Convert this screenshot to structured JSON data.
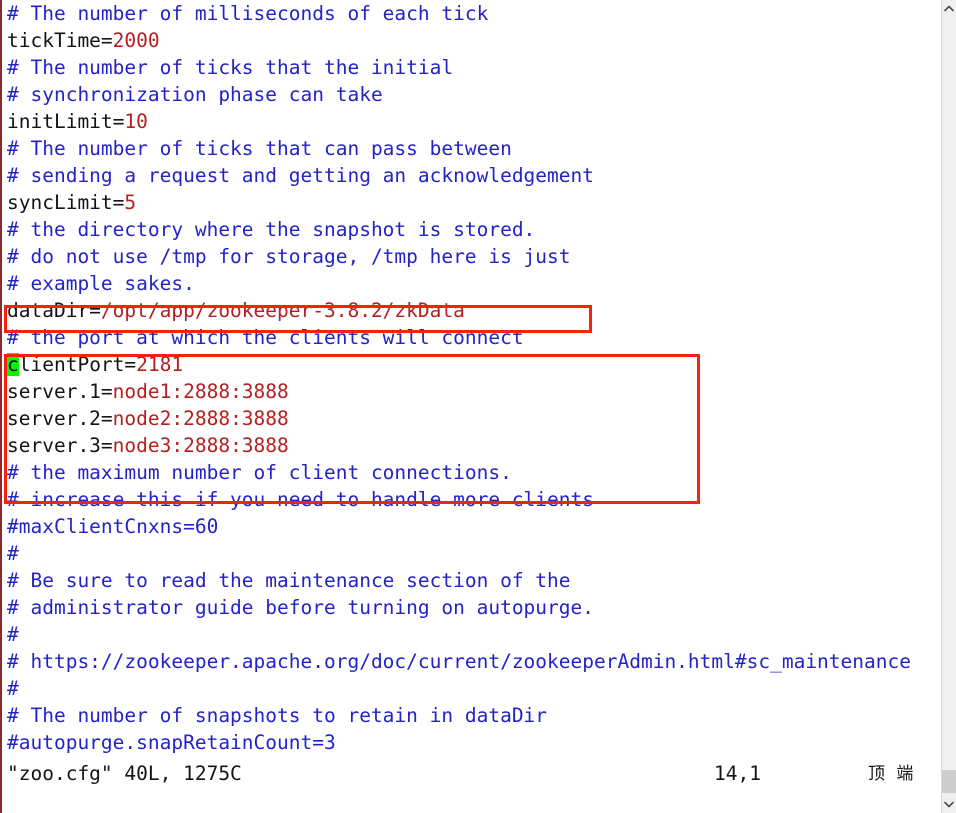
{
  "window": {
    "app": "vim",
    "filename": "zoo.cfg"
  },
  "editor": {
    "lines": [
      {
        "type": "comment",
        "text": "# The number of milliseconds of each tick"
      },
      {
        "type": "setting",
        "key": "tickTime=",
        "value": "2000"
      },
      {
        "type": "comment",
        "text": "# The number of ticks that the initial"
      },
      {
        "type": "comment",
        "text": "# synchronization phase can take"
      },
      {
        "type": "setting",
        "key": "initLimit=",
        "value": "10"
      },
      {
        "type": "comment",
        "text": "# The number of ticks that can pass between"
      },
      {
        "type": "comment",
        "text": "# sending a request and getting an acknowledgement"
      },
      {
        "type": "setting",
        "key": "syncLimit=",
        "value": "5"
      },
      {
        "type": "comment",
        "text": "# the directory where the snapshot is stored."
      },
      {
        "type": "comment",
        "text": "# do not use /tmp for storage, /tmp here is just"
      },
      {
        "type": "comment",
        "text": "# example sakes."
      },
      {
        "type": "setting",
        "key": "dataDir=",
        "value": "/opt/app/zookeeper-3.8.2/zkData"
      },
      {
        "type": "comment",
        "text": "# the port at which the clients will connect"
      },
      {
        "type": "setting-cursor",
        "cursor": "c",
        "key": "lientPort=",
        "value": "2181"
      },
      {
        "type": "setting",
        "key": "server.1=",
        "value": "node1:2888:3888"
      },
      {
        "type": "setting",
        "key": "server.2=",
        "value": "node2:2888:3888"
      },
      {
        "type": "setting",
        "key": "server.3=",
        "value": "node3:2888:3888"
      },
      {
        "type": "comment",
        "text": "# the maximum number of client connections."
      },
      {
        "type": "comment",
        "text": "# increase this if you need to handle more clients"
      },
      {
        "type": "comment",
        "text": "#maxClientCnxns=60"
      },
      {
        "type": "comment",
        "text": "#"
      },
      {
        "type": "comment",
        "text": "# Be sure to read the maintenance section of the"
      },
      {
        "type": "comment",
        "text": "# administrator guide before turning on autopurge."
      },
      {
        "type": "comment",
        "text": "#"
      },
      {
        "type": "comment",
        "text": "# https://zookeeper.apache.org/doc/current/zookeeperAdmin.html#sc_maintenance"
      },
      {
        "type": "comment",
        "text": "#"
      },
      {
        "type": "comment",
        "text": "# The number of snapshots to retain in dataDir"
      },
      {
        "type": "comment",
        "text": "#autopurge.snapRetainCount=3"
      }
    ]
  },
  "statusline": {
    "file_info": "\"zoo.cfg\" 40L, 1275C",
    "cursor_position": "14,1",
    "location": "顶 端"
  },
  "annotations": [
    {
      "name": "datadir-highlight",
      "color": "#f92010"
    },
    {
      "name": "server-config-highlight",
      "color": "#f92010"
    }
  ],
  "scrollbar": {
    "up_arrow": "chevron-up-icon",
    "down_arrow": "chevron-down-icon",
    "thumb": "scrollbar-thumb"
  },
  "colors": {
    "comment": "#2323c8",
    "value": "#b41f1f",
    "key": "#141414",
    "cursor_bg": "#00f900",
    "annotation": "#f92010",
    "window_border": "#8a2a2a"
  }
}
